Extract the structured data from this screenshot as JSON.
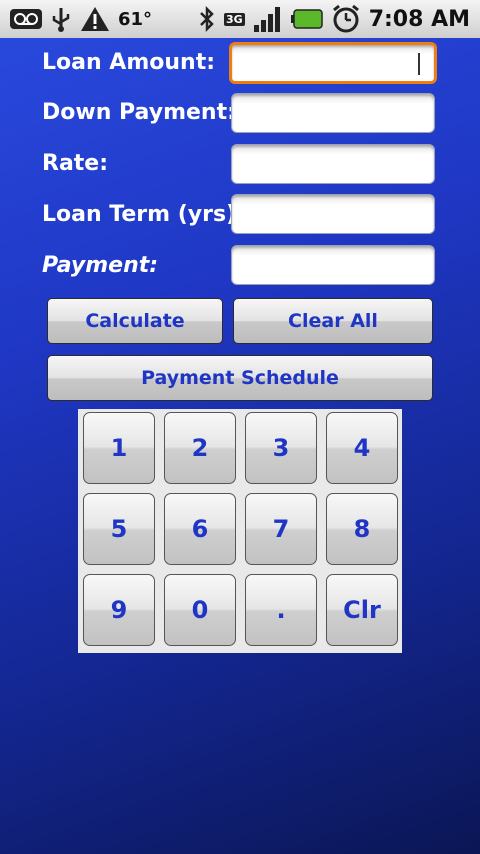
{
  "status_bar": {
    "temperature": "61°",
    "network": "3G",
    "time": "7:08 AM",
    "icons": [
      "voicemail-icon",
      "usb-icon",
      "warning-icon",
      "bluetooth-icon",
      "3g-icon",
      "signal-icon",
      "battery-icon",
      "alarm-icon"
    ]
  },
  "form": {
    "loan_amount": {
      "label": "Loan Amount:",
      "value": ""
    },
    "down_payment": {
      "label": "Down Payment:",
      "value": ""
    },
    "rate": {
      "label": "Rate:",
      "value": ""
    },
    "loan_term": {
      "label": "Loan Term (yrs):",
      "value": ""
    },
    "payment": {
      "label": "Payment:",
      "value": ""
    }
  },
  "buttons": {
    "calculate": "Calculate",
    "clear_all": "Clear All",
    "payment_schedule": "Payment Schedule"
  },
  "keypad": {
    "keys": [
      "1",
      "2",
      "3",
      "4",
      "5",
      "6",
      "7",
      "8",
      "9",
      "0",
      ".",
      "Clr"
    ]
  },
  "colors": {
    "accent_text": "#1f35c5",
    "focus_border": "#f07d10",
    "background": "#1f37c4"
  }
}
